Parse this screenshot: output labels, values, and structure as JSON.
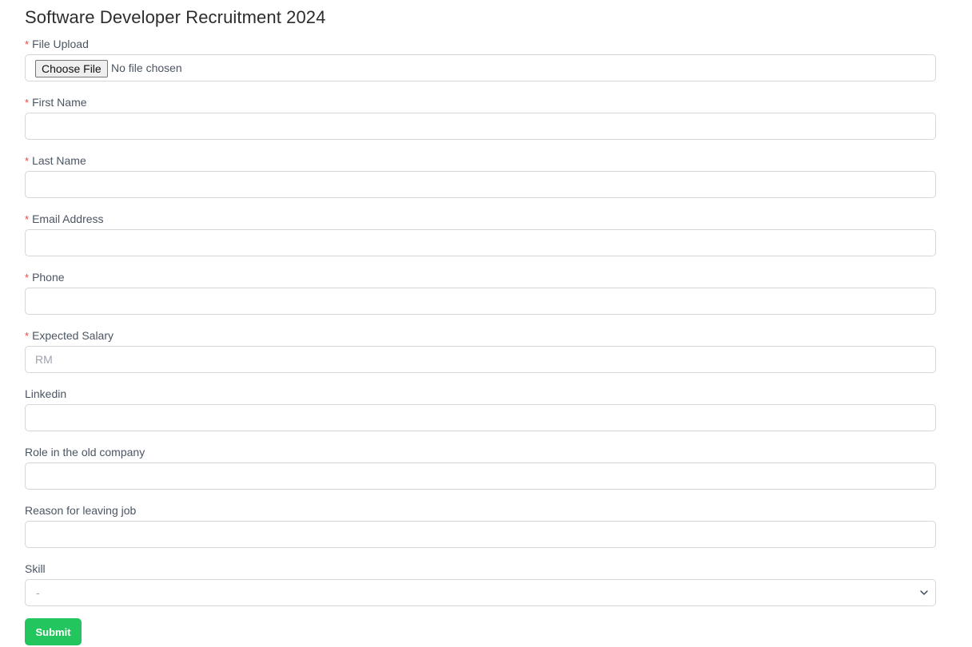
{
  "form": {
    "title": "Software Developer Recruitment 2024",
    "required_marker": "*",
    "file_upload": {
      "label": "File Upload",
      "required": true,
      "button_label": "Choose File",
      "status_text": "No file chosen"
    },
    "fields": [
      {
        "id": "first-name",
        "label": "First Name",
        "required": true,
        "value": "",
        "placeholder": ""
      },
      {
        "id": "last-name",
        "label": "Last Name",
        "required": true,
        "value": "",
        "placeholder": ""
      },
      {
        "id": "email",
        "label": "Email Address",
        "required": true,
        "value": "",
        "placeholder": ""
      },
      {
        "id": "phone",
        "label": "Phone",
        "required": true,
        "value": "",
        "placeholder": ""
      },
      {
        "id": "expected-salary",
        "label": "Expected Salary",
        "required": true,
        "value": "",
        "placeholder": "RM"
      },
      {
        "id": "linkedin",
        "label": "Linkedin",
        "required": false,
        "value": "",
        "placeholder": ""
      },
      {
        "id": "old-role",
        "label": "Role in the old company",
        "required": false,
        "value": "",
        "placeholder": ""
      },
      {
        "id": "leaving-reason",
        "label": "Reason for leaving job",
        "required": false,
        "value": "",
        "placeholder": ""
      }
    ],
    "skill": {
      "label": "Skill",
      "required": false,
      "selected": "-",
      "icon": "chevron-down-icon"
    },
    "submit_label": "Submit"
  },
  "colors": {
    "required": "#ef4444",
    "submit": "#22c55e"
  }
}
